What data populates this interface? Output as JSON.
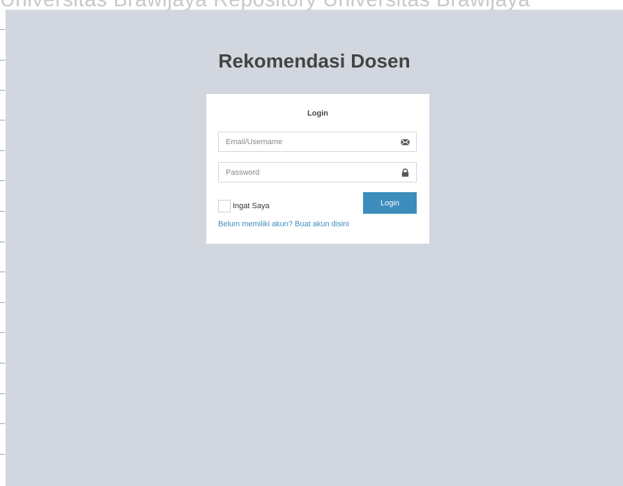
{
  "watermark": {
    "text": "Universitas Brawijaya   Repository Universitas Brawijaya"
  },
  "brand": {
    "title": "Rekomendasi Dosen"
  },
  "login": {
    "heading": "Login",
    "email_placeholder": "Email/Username",
    "email_value": "",
    "email_icon": "envelope-icon",
    "password_placeholder": "Password",
    "password_value": "",
    "password_icon": "lock-icon",
    "remember_label": "Ingat Saya",
    "remember_checked": false,
    "submit_label": "Login",
    "register_link": "Belum memiliki akun? Buat akun disini"
  },
  "colors": {
    "background": "#d2d6de",
    "button": "#3c8dbc",
    "link": "#3c8dbc",
    "title": "#444444"
  }
}
